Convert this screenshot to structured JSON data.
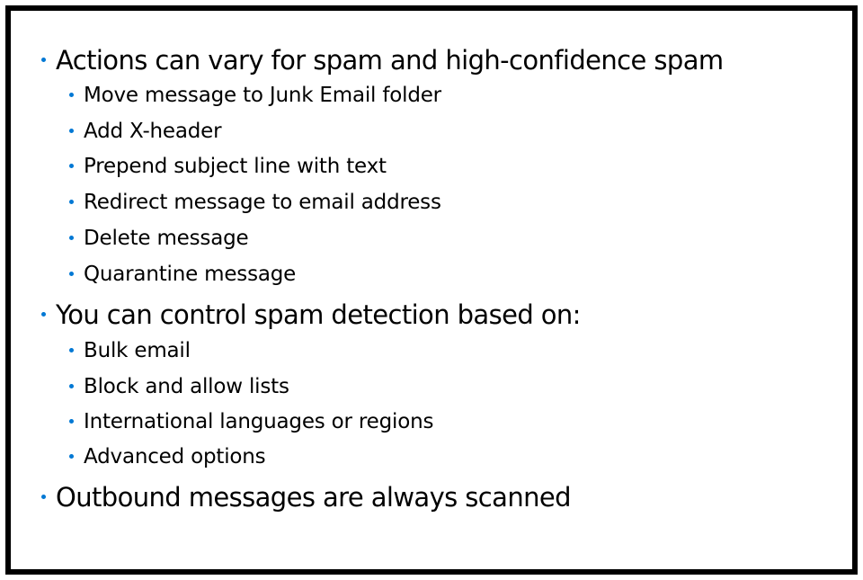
{
  "slide": {
    "bullets": [
      {
        "level": 1,
        "text": "Actions can vary for spam and high-confidence spam"
      },
      {
        "level": 2,
        "text": "Move message to Junk Email folder"
      },
      {
        "level": 2,
        "text": "Add X-header"
      },
      {
        "level": 2,
        "text": "Prepend subject line with text"
      },
      {
        "level": 2,
        "text": "Redirect message to email address"
      },
      {
        "level": 2,
        "text": "Delete message"
      },
      {
        "level": 2,
        "text": "Quarantine message"
      },
      {
        "level": 1,
        "text": "You can control spam detection based on:"
      },
      {
        "level": 2,
        "text": "Bulk email"
      },
      {
        "level": 2,
        "text": "Block and allow lists"
      },
      {
        "level": 2,
        "text": "International languages or regions"
      },
      {
        "level": 2,
        "text": "Advanced options"
      },
      {
        "level": 1,
        "text": "Outbound messages are always scanned"
      }
    ]
  },
  "colors": {
    "bullet": "#0078d4",
    "text": "#000000",
    "border": "#000000",
    "background": "#ffffff"
  }
}
